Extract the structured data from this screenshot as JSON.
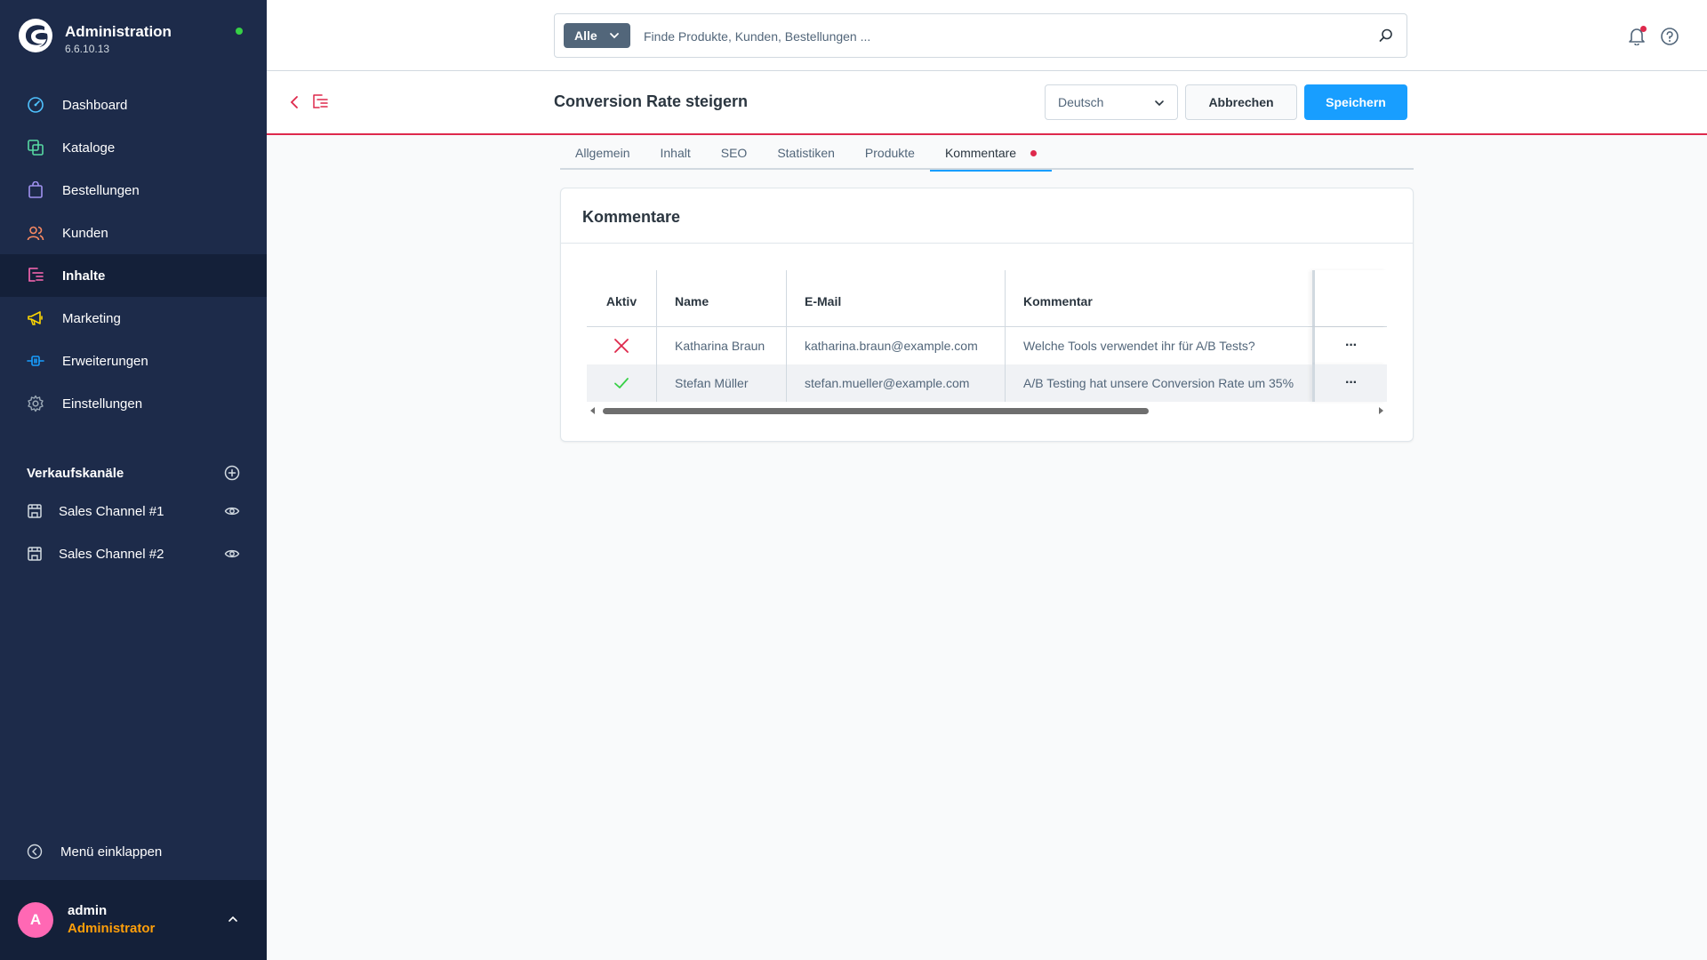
{
  "app": {
    "title": "Administration",
    "version": "6.6.10.13"
  },
  "colors": {
    "sidebar": "#1d2b4a",
    "accent": "#189eff",
    "danger": "#de294c",
    "success": "#37d046",
    "role": "#ff9f0a"
  },
  "sidebar": {
    "items": [
      {
        "label": "Dashboard",
        "icon": "dashboard-icon"
      },
      {
        "label": "Kataloge",
        "icon": "catalog-icon"
      },
      {
        "label": "Bestellungen",
        "icon": "orders-bag-icon"
      },
      {
        "label": "Kunden",
        "icon": "customers-icon"
      },
      {
        "label": "Inhalte",
        "icon": "content-icon",
        "active": true
      },
      {
        "label": "Marketing",
        "icon": "megaphone-icon"
      },
      {
        "label": "Erweiterungen",
        "icon": "plug-icon"
      },
      {
        "label": "Einstellungen",
        "icon": "gear-icon"
      }
    ],
    "channels_title": "Verkaufskanäle",
    "channels": [
      {
        "label": "Sales Channel #1"
      },
      {
        "label": "Sales Channel #2"
      }
    ],
    "collapse_label": "Menü einklappen"
  },
  "user": {
    "initial": "A",
    "name": "admin",
    "role": "Administrator"
  },
  "search": {
    "type_label": "Alle",
    "placeholder": "Finde Produkte, Kunden, Bestellungen ..."
  },
  "smartbar": {
    "title": "Conversion Rate steigern",
    "language": "Deutsch",
    "cancel_label": "Abbrechen",
    "save_label": "Speichern"
  },
  "tabs": [
    {
      "label": "Allgemein"
    },
    {
      "label": "Inhalt"
    },
    {
      "label": "SEO"
    },
    {
      "label": "Statistiken"
    },
    {
      "label": "Produkte"
    },
    {
      "label": "Kommentare",
      "active": true
    }
  ],
  "comments": {
    "title": "Kommentare",
    "columns": {
      "active": "Aktiv",
      "name": "Name",
      "email": "E-Mail",
      "comment": "Kommentar"
    },
    "rows": [
      {
        "active": false,
        "name": "Katharina Braun",
        "email": "katharina.braun@example.com",
        "comment": "Welche Tools verwendet ihr für A/B Tests?"
      },
      {
        "active": true,
        "name": "Stefan Müller",
        "email": "stefan.mueller@example.com",
        "comment": "A/B Testing hat unsere Conversion Rate um 35%"
      }
    ],
    "actions_glyph": "···"
  }
}
